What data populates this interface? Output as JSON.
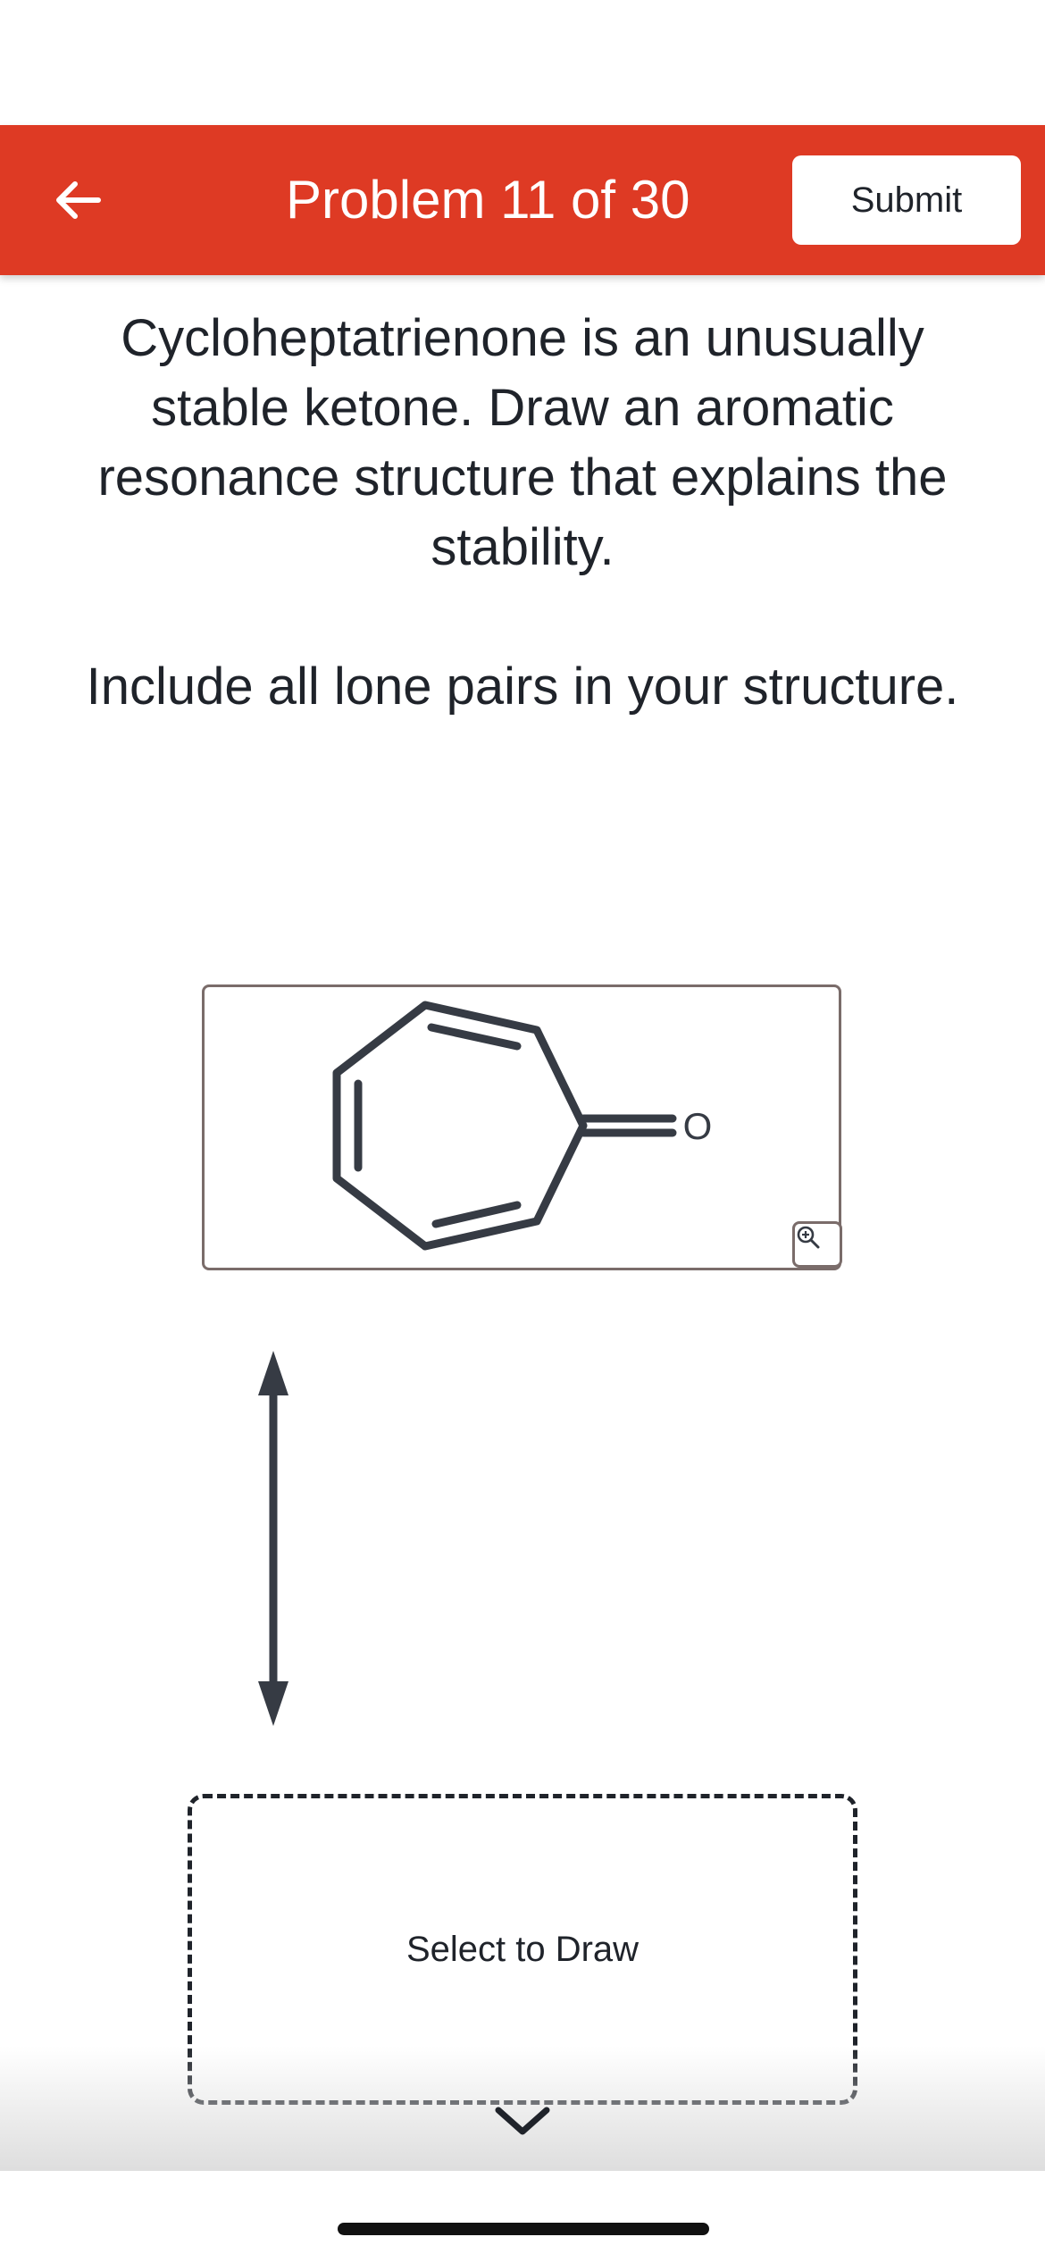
{
  "header": {
    "title": "Problem 11 of 30",
    "submit_label": "Submit",
    "back_icon": "arrow-left-icon",
    "background_color": "#de3a24"
  },
  "question": {
    "text": "Cycloheptatrienone is an unusually stable ketone. Draw an aromatic resonance structure that explains the stability.",
    "instruction": "Include all lone pairs in your structure."
  },
  "structure": {
    "atom_label": "O",
    "zoom_icon": "zoom-in-icon"
  },
  "resonance_arrow_icon": "double-headed-arrow-icon",
  "draw_area": {
    "label": "Select to Draw"
  },
  "expand_icon": "chevron-down-icon"
}
